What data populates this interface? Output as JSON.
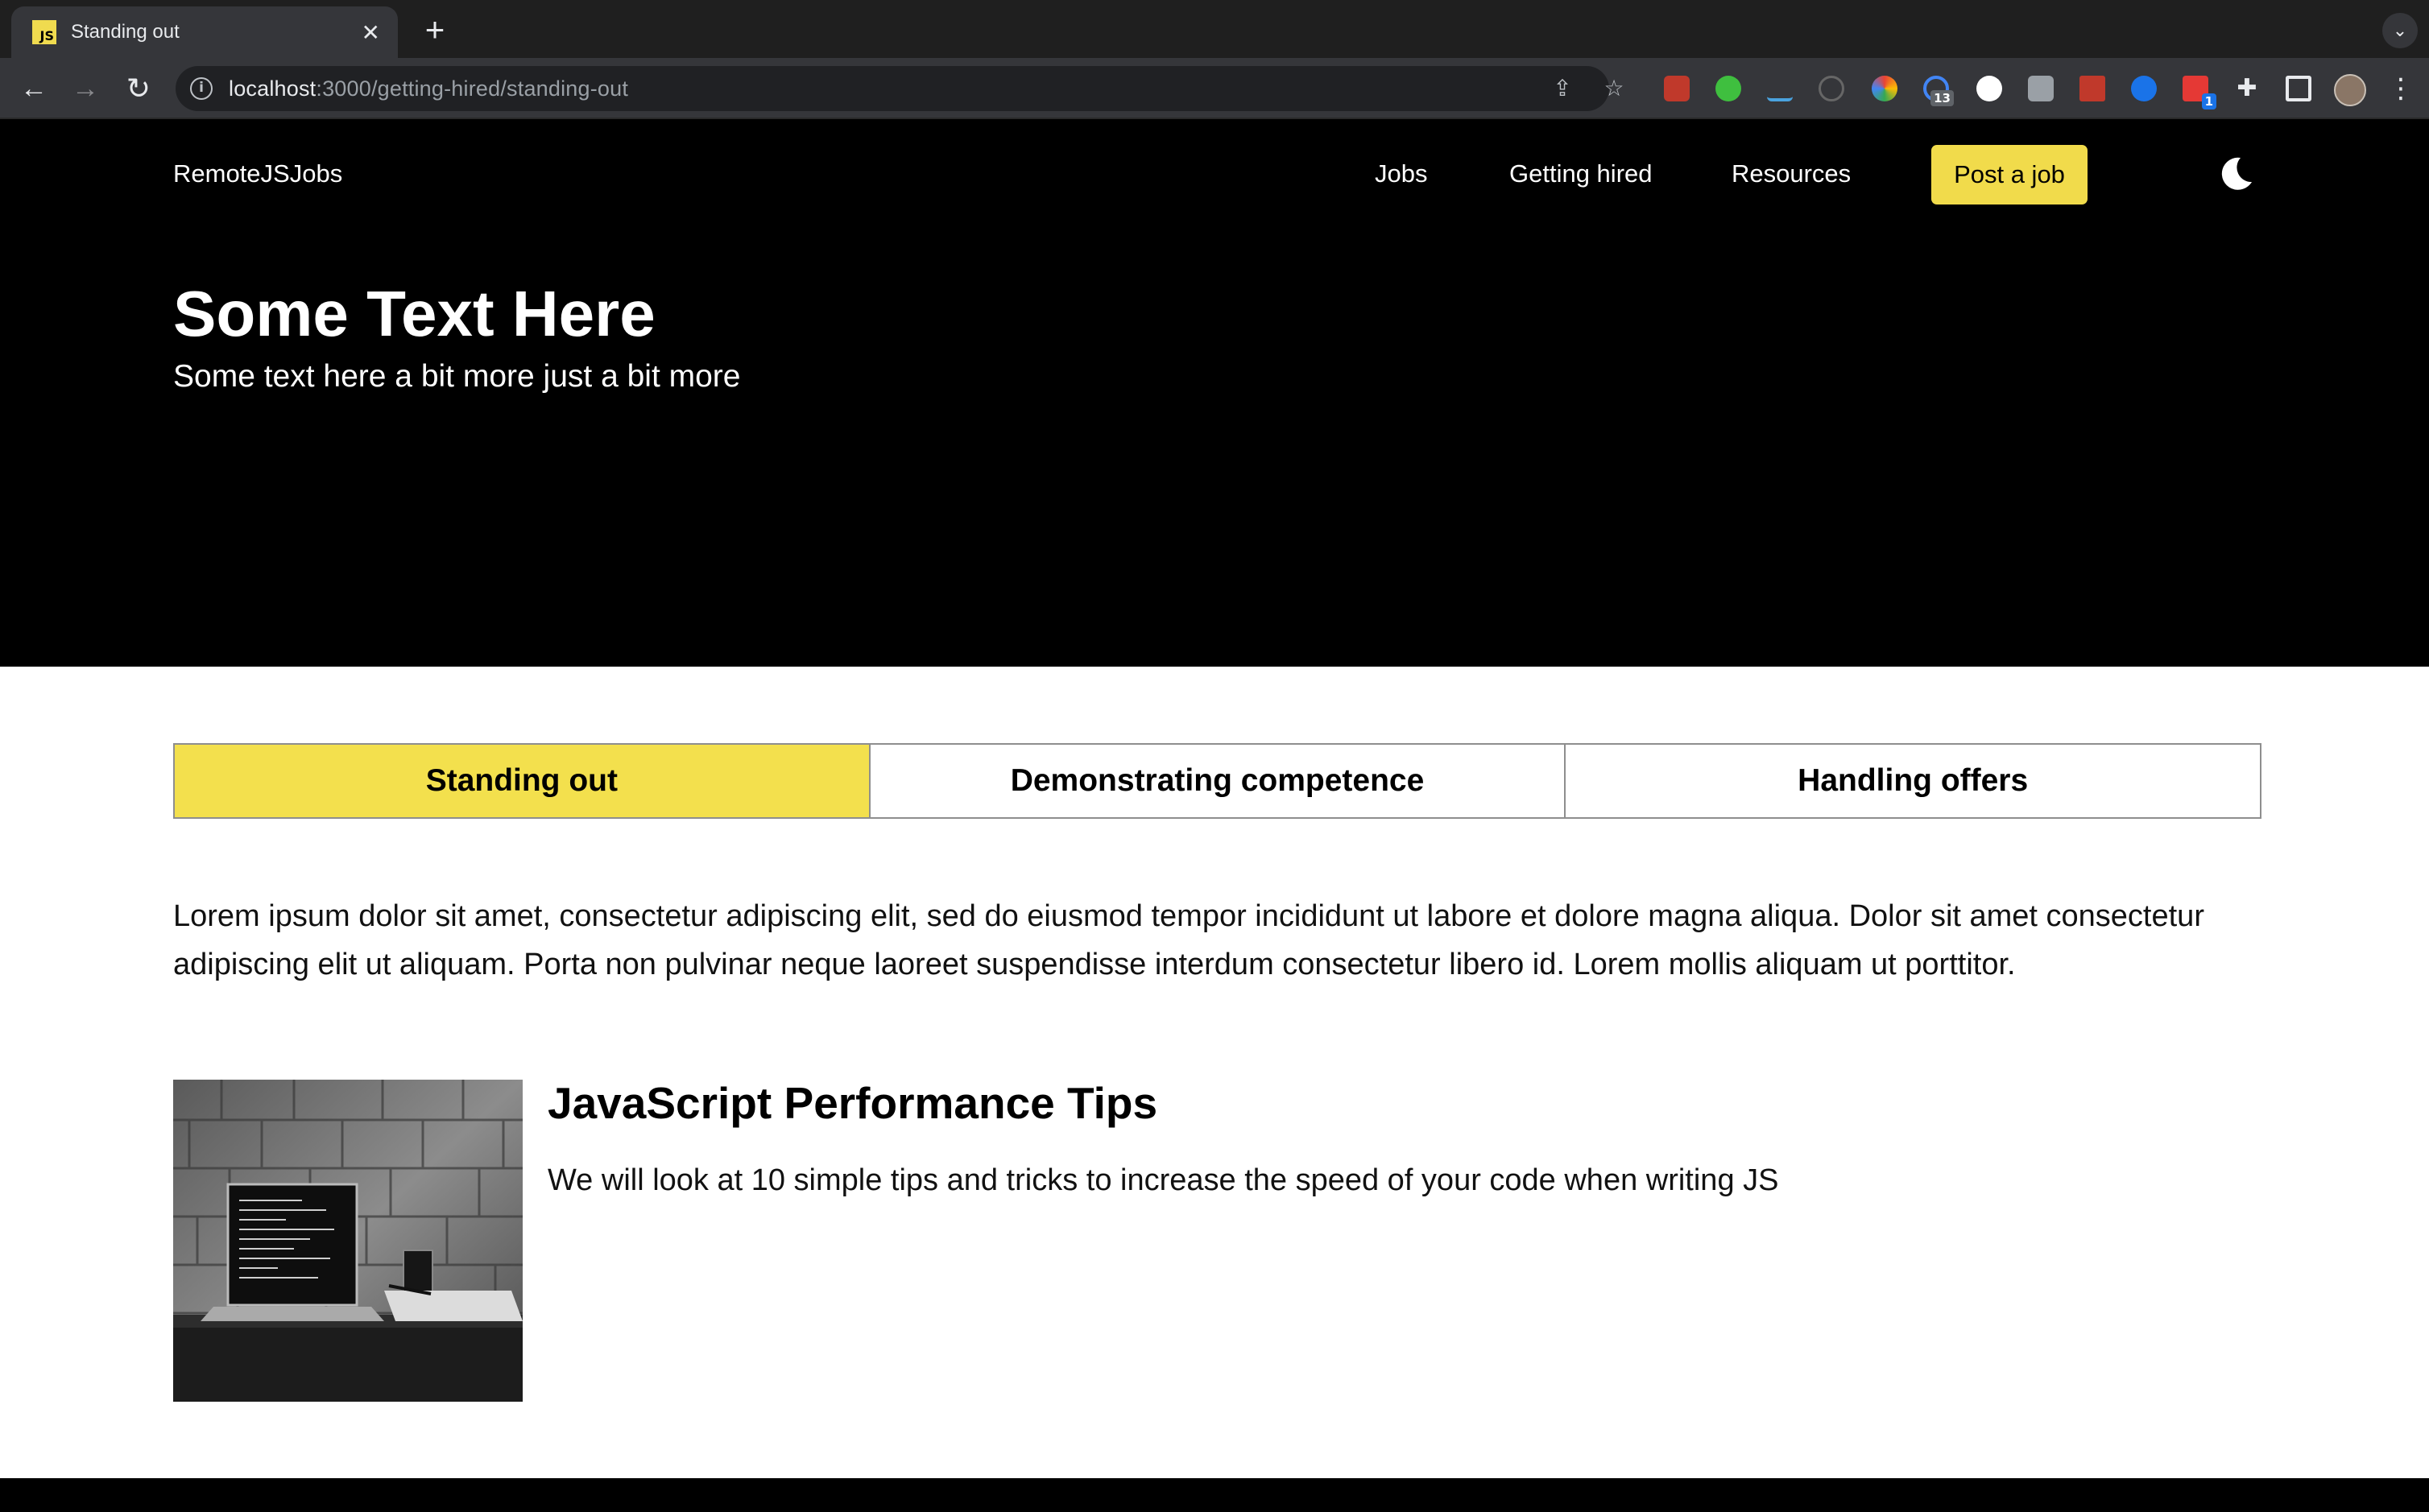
{
  "browser": {
    "tab": {
      "title": "Standing out",
      "favicon_text": "JS"
    },
    "new_tab_label": "+",
    "url": {
      "host": "localhost",
      "path": ":3000/getting-hired/standing-out"
    },
    "extension_badges": {
      "ext6": "13",
      "ext14": "1"
    }
  },
  "site": {
    "logo": "RemoteJSJobs",
    "nav": {
      "jobs": "Jobs",
      "getting_hired": "Getting hired",
      "resources": "Resources"
    },
    "post_job": "Post a job",
    "accent_color": "#f1db4b"
  },
  "hero": {
    "title": "Some Text Here",
    "subtitle": "Some text here a bit more just a bit more"
  },
  "tabs": [
    {
      "label": "Standing out",
      "active": true
    },
    {
      "label": "Demonstrating competence",
      "active": false
    },
    {
      "label": "Handling offers",
      "active": false
    }
  ],
  "intro": "Lorem ipsum dolor sit amet, consectetur adipiscing elit, sed do eiusmod tempor incididunt ut labore et dolore magna aliqua. Dolor sit amet consectetur adipiscing elit ut aliquam. Porta non pulvinar neque laoreet suspendisse interdum consectetur libero id. Lorem mollis aliquam ut porttitor.",
  "article": {
    "title": "JavaScript Performance Tips",
    "description": "We will look at 10 simple tips and tricks to increase the speed of your code when writing JS",
    "image": "laptop-on-desk-photo"
  }
}
